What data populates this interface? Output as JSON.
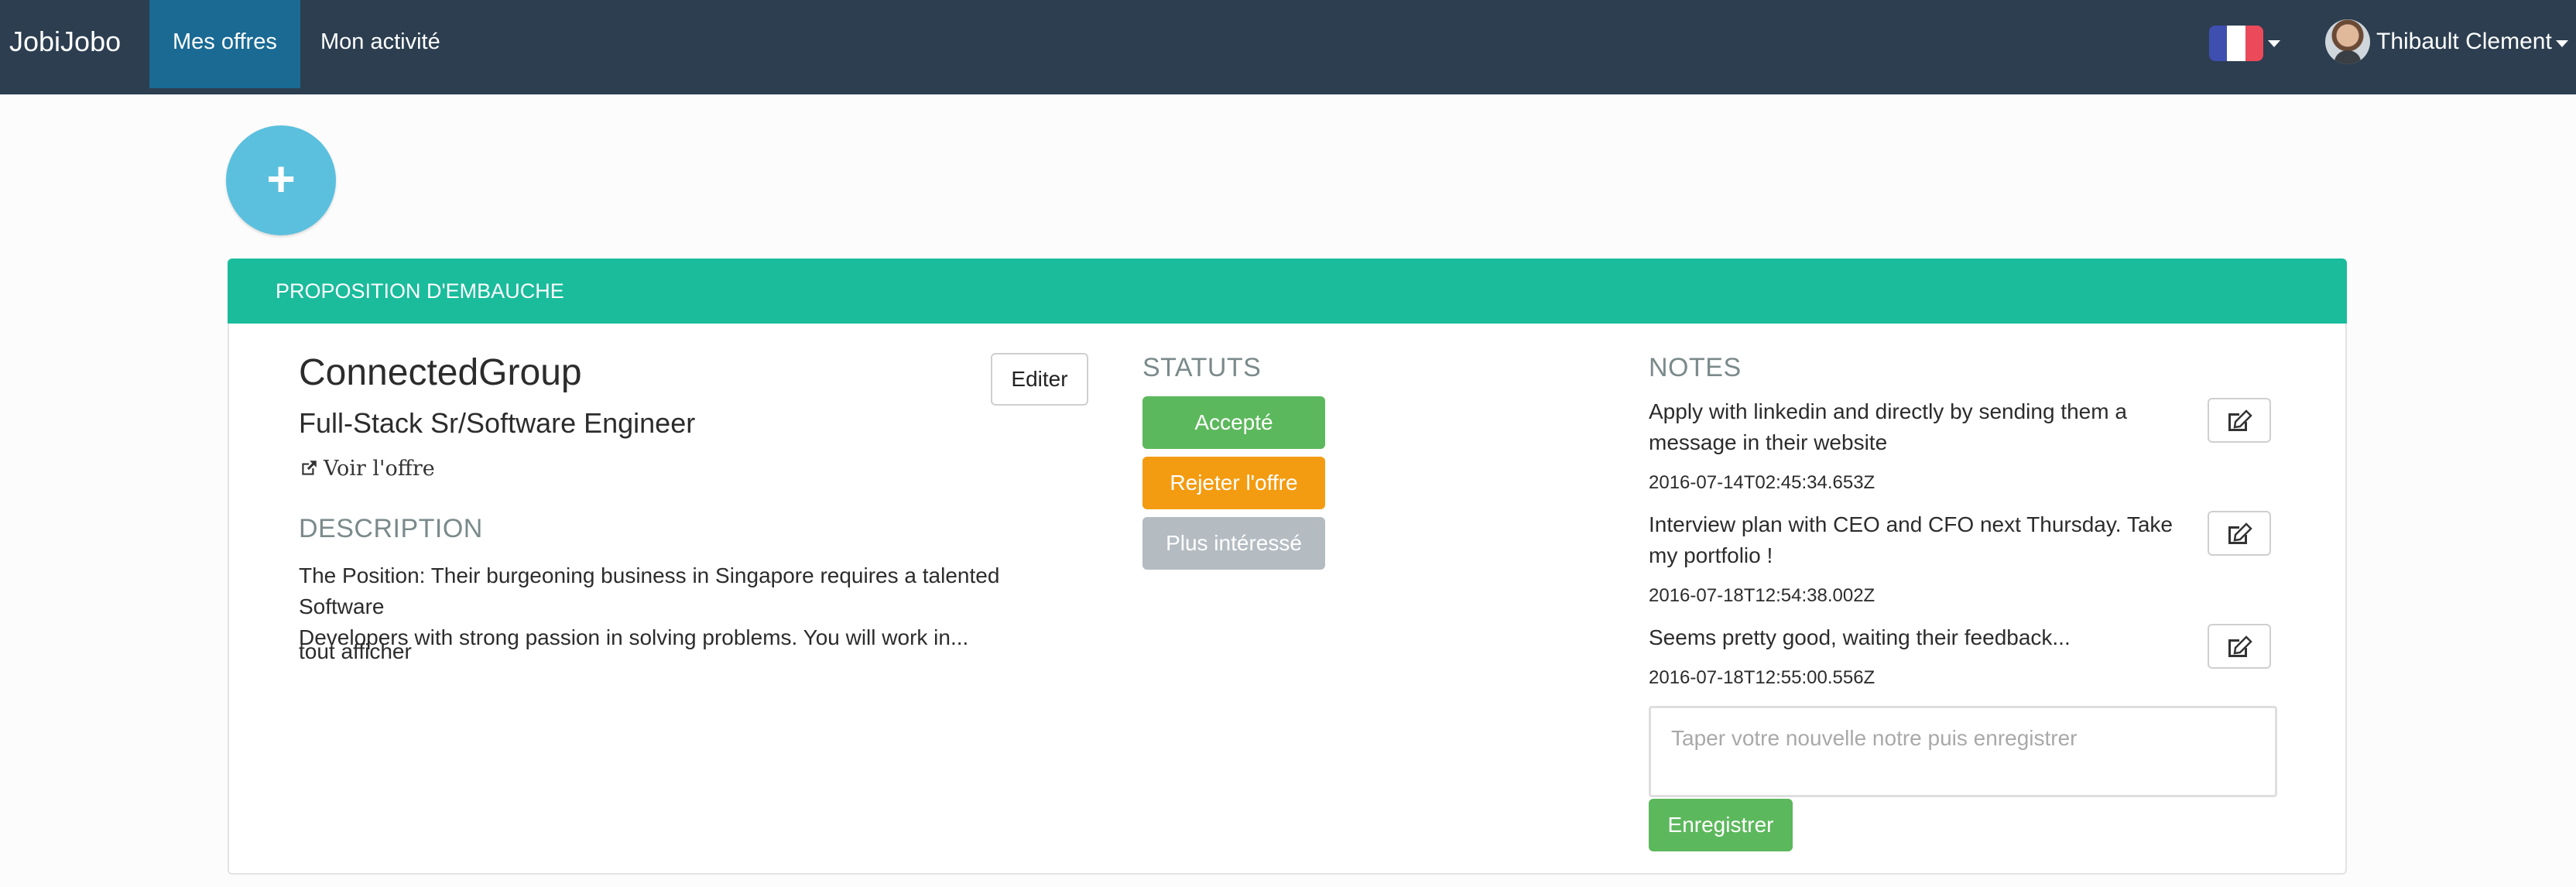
{
  "navbar": {
    "brand": "JobiJobo",
    "nav_items": [
      "Mes offres",
      "Mon activité"
    ],
    "active_index": 0,
    "user_name": "Thibault Clement",
    "language_flag": "flag-fr-icon",
    "colors": {
      "background": "#2c3e50",
      "active": "#1a6a94"
    }
  },
  "add_button": {
    "label": "+",
    "icon": "plus-icon",
    "color": "#5bc0de"
  },
  "panel": {
    "heading": "PROPOSITION D'EMBAUCHE",
    "heading_color": "#1abc9c",
    "company": "ConnectedGroup",
    "position": "Full-Stack Sr/Software Engineer",
    "offer_link": "Voir l'offre",
    "edit_label": "Editer",
    "description_title": "DESCRIPTION",
    "description_line1": "The Position: Their burgeoning business in Singapore requires a talented Software",
    "description_line2": "Developers with strong passion in solving problems. You will work in...",
    "show_all": "tout afficher",
    "status_title": "STATUTS",
    "statuses": [
      {
        "label": "Accepté",
        "color": "#5cb85c"
      },
      {
        "label": "Rejeter l'offre",
        "color": "#f39c12"
      },
      {
        "label": "Plus intéressé",
        "color": "#b4bcc2"
      }
    ],
    "notes_title": "NOTES",
    "notes": [
      {
        "line1": "Apply with linkedin and directly by sending them a",
        "line2": "message in their website",
        "date": "2016-07-14T02:45:34.653Z"
      },
      {
        "line1": "Interview plan with CEO and CFO next Thursday. Take",
        "line2": "my portfolio !",
        "date": "2016-07-18T12:54:38.002Z"
      },
      {
        "line1": "Seems pretty good, waiting their feedback...",
        "line2": "",
        "date": "2016-07-18T12:55:00.556Z"
      }
    ],
    "note_input_placeholder": "Taper votre nouvelle notre puis enregistrer",
    "save_label": "Enregistrer"
  }
}
